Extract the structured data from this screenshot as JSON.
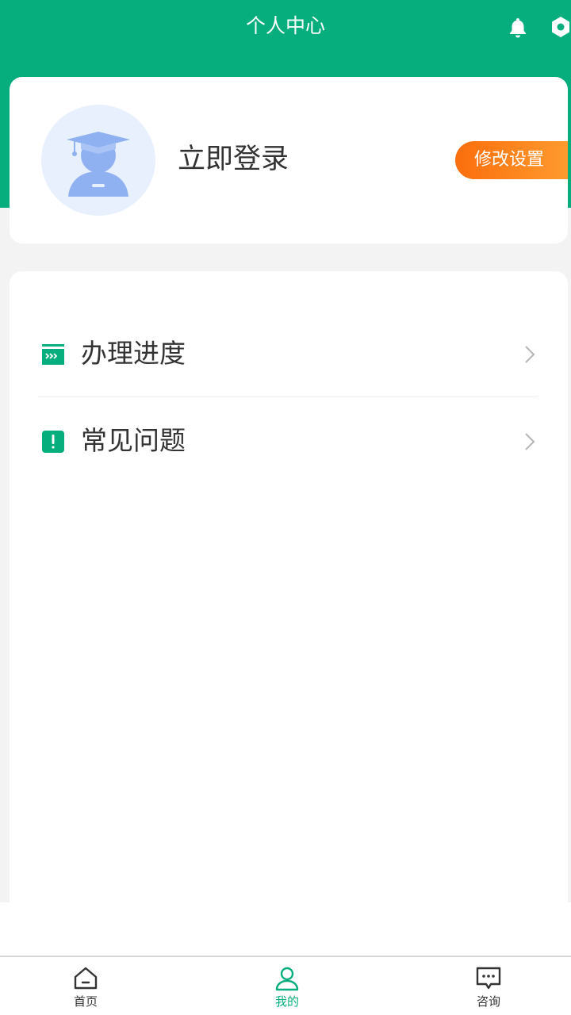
{
  "header": {
    "title": "个人中心",
    "bell_icon": "bell-icon",
    "settings_icon": "gear-icon"
  },
  "profile": {
    "avatar_icon": "student-avatar-icon",
    "login_label": "立即登录",
    "settings_button_label": "修改设置"
  },
  "menu": {
    "items": [
      {
        "label": "办理进度",
        "icon": "progress-icon"
      },
      {
        "label": "常见问题",
        "icon": "exclamation-icon"
      }
    ]
  },
  "tabbar": {
    "items": [
      {
        "label": "首页",
        "icon": "home-icon"
      },
      {
        "label": "我的",
        "icon": "user-icon",
        "active": true
      },
      {
        "label": "咨询",
        "icon": "chat-icon"
      }
    ]
  },
  "colors": {
    "brand": "#07ae7d",
    "accent_orange": "#fb6e0d",
    "avatar_blue": "#8fb1f2"
  }
}
